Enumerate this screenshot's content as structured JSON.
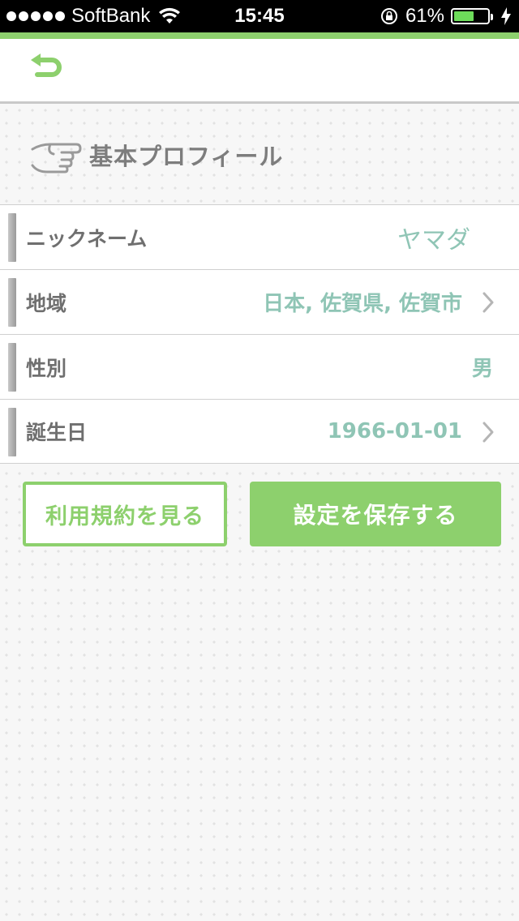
{
  "status_bar": {
    "carrier": "SoftBank",
    "time": "15:45",
    "battery": "61%",
    "battery_level": 0.61
  },
  "section": {
    "title": "基本プロフィール"
  },
  "rows": [
    {
      "label": "ニックネーム",
      "value": "ヤマダ"
    },
    {
      "label": "地域",
      "value": "日本, 佐賀県, 佐賀市"
    },
    {
      "label": "性別",
      "value": "男"
    },
    {
      "label": "誕生日",
      "value": "1966-01-01"
    }
  ],
  "buttons": {
    "terms": "利用規約を見る",
    "save": "設定を保存する"
  },
  "colors": {
    "accent_green": "#8dd06d",
    "value_teal": "#8fc5b5"
  }
}
